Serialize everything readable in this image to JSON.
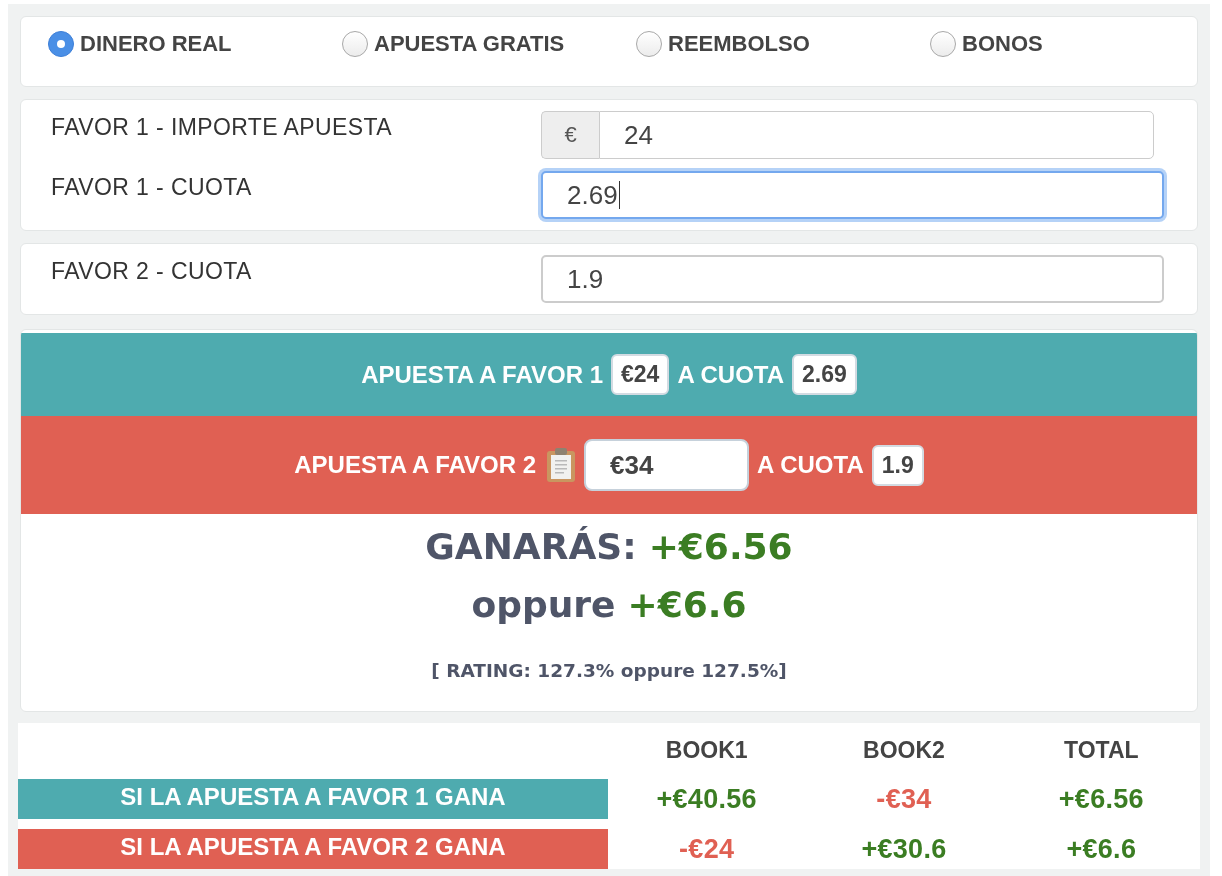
{
  "bet_types": [
    {
      "label": "DINERO REAL",
      "selected": true
    },
    {
      "label": "APUESTA GRATIS",
      "selected": false
    },
    {
      "label": "REEMBOLSO",
      "selected": false
    },
    {
      "label": "BONOS",
      "selected": false
    }
  ],
  "panels": [
    {
      "fields": [
        {
          "label": "FAVOR 1 - IMPORTE APUESTA",
          "prefix": "€",
          "value": "24",
          "focused": false
        },
        {
          "label": "FAVOR 1 - CUOTA",
          "value": "2.69",
          "focused": true
        }
      ]
    },
    {
      "fields": [
        {
          "label": "FAVOR 2 - CUOTA",
          "value": "1.9",
          "focused": false
        }
      ]
    }
  ],
  "bets": [
    {
      "kind": "fixed",
      "color": "#4eabaf",
      "label": "APUESTA A FAVOR 1",
      "stake": "€24",
      "odds_label": "A CUOTA",
      "odds": "2.69"
    },
    {
      "kind": "input",
      "color": "#e06053",
      "label": "APUESTA A FAVOR 2",
      "stake": "€34",
      "odds_label": "A CUOTA",
      "odds": "1.9"
    }
  ],
  "result": {
    "label": "GANARÁS:",
    "profit": "+€6.56",
    "alt_label": "oppure",
    "alt_profit": "+€6.6",
    "rating": "[ RATING: 127.3% oppure 127.5%]"
  },
  "table": {
    "columns": [
      "BOOK1",
      "BOOK2",
      "TOTAL"
    ],
    "rows": [
      {
        "label": "SI LA APUESTA A FAVOR 1 GANA",
        "color": "#4eabaf",
        "cells": [
          {
            "value": "+€40.56",
            "color": "#3b7d23"
          },
          {
            "value": "-€34",
            "color": "#e06053"
          },
          {
            "value": "+€6.56",
            "color": "#3b7d23"
          }
        ]
      },
      {
        "label": "SI LA APUESTA A FAVOR 2 GANA",
        "color": "#e06053",
        "cells": [
          {
            "value": "-€24",
            "color": "#e06053"
          },
          {
            "value": "+€30.6",
            "color": "#3b7d23"
          },
          {
            "value": "+€6.6",
            "color": "#3b7d23"
          }
        ]
      }
    ]
  }
}
